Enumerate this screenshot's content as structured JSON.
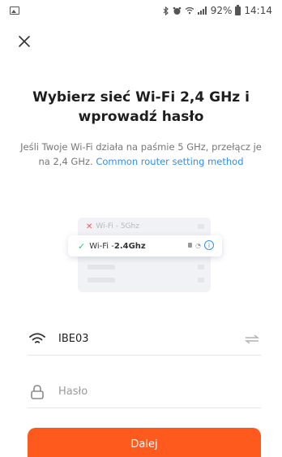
{
  "status_bar": {
    "battery": "92%",
    "time": "14:14"
  },
  "header": {
    "title": "Wybierz sieć Wi-Fi 2,4 GHz i wprowadź hasło",
    "description": "Jeśli Twoje Wi-Fi działa na paśmie 5 GHz, przełącz je na 2,4 GHz.",
    "link_text": "Common router setting method"
  },
  "illustration": {
    "row_5ghz": "Wi-Fi - 5Ghz",
    "row_24_prefix": "Wi-Fi - ",
    "row_24_band": "2.4Ghz"
  },
  "form": {
    "wifi_name": "IBE03",
    "password_placeholder": "Hasło"
  },
  "actions": {
    "next_label": "Dalej"
  },
  "colors": {
    "accent": "#ff5a1e",
    "link": "#2f8ff0"
  }
}
